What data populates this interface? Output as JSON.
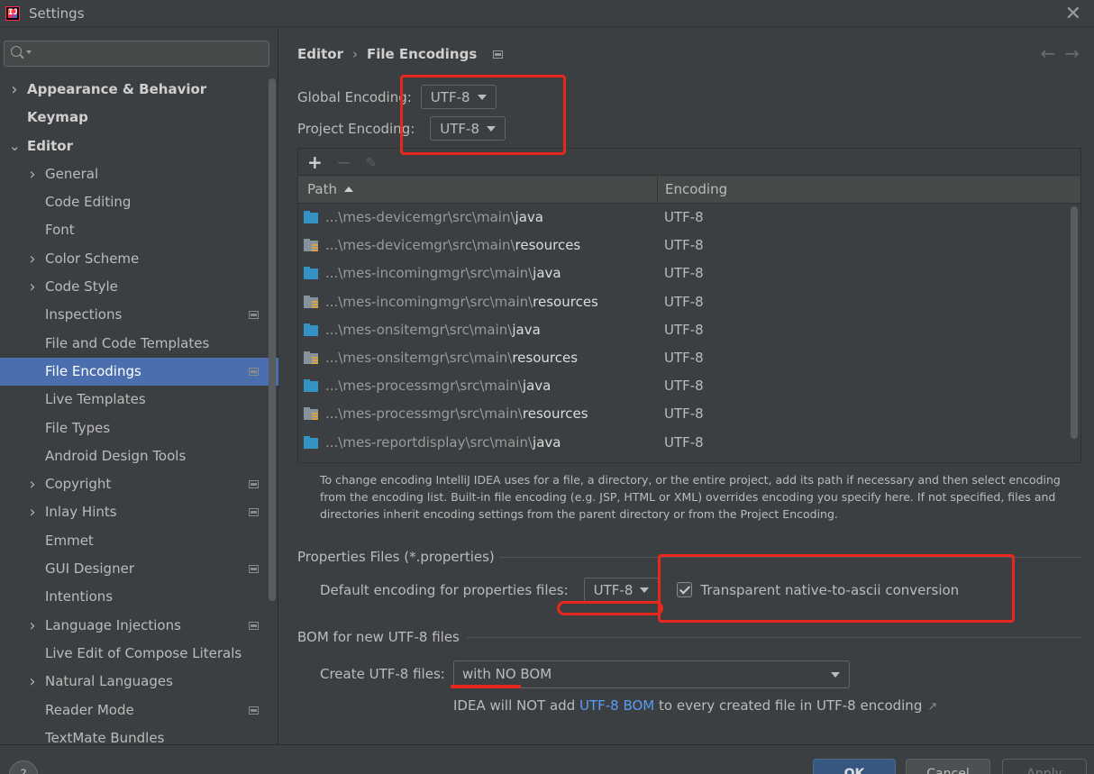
{
  "window": {
    "title": "Settings",
    "icon": "intellij-logo-icon"
  },
  "search": {
    "placeholder": "",
    "value": ""
  },
  "sidebar": {
    "items": [
      {
        "label": "Appearance & Behavior",
        "level": 0,
        "expandable": true,
        "expanded": false,
        "bold": true
      },
      {
        "label": "Keymap",
        "level": 0,
        "expandable": false,
        "bold": true
      },
      {
        "label": "Editor",
        "level": 0,
        "expandable": true,
        "expanded": true,
        "bold": true
      },
      {
        "label": "General",
        "level": 1,
        "expandable": true
      },
      {
        "label": "Code Editing",
        "level": 1
      },
      {
        "label": "Font",
        "level": 1
      },
      {
        "label": "Color Scheme",
        "level": 1,
        "expandable": true
      },
      {
        "label": "Code Style",
        "level": 1,
        "expandable": true
      },
      {
        "label": "Inspections",
        "level": 1,
        "project": true
      },
      {
        "label": "File and Code Templates",
        "level": 1
      },
      {
        "label": "File Encodings",
        "level": 1,
        "project": true,
        "selected": true
      },
      {
        "label": "Live Templates",
        "level": 1
      },
      {
        "label": "File Types",
        "level": 1
      },
      {
        "label": "Android Design Tools",
        "level": 1
      },
      {
        "label": "Copyright",
        "level": 1,
        "expandable": true,
        "project": true
      },
      {
        "label": "Inlay Hints",
        "level": 1,
        "expandable": true,
        "project": true
      },
      {
        "label": "Emmet",
        "level": 1
      },
      {
        "label": "GUI Designer",
        "level": 1,
        "project": true
      },
      {
        "label": "Intentions",
        "level": 1
      },
      {
        "label": "Language Injections",
        "level": 1,
        "expandable": true,
        "project": true
      },
      {
        "label": "Live Edit of Compose Literals",
        "level": 1
      },
      {
        "label": "Natural Languages",
        "level": 1,
        "expandable": true
      },
      {
        "label": "Reader Mode",
        "level": 1,
        "project": true
      },
      {
        "label": "TextMate Bundles",
        "level": 1
      }
    ]
  },
  "breadcrumb": {
    "parent": "Editor",
    "separator": "›",
    "current": "File Encodings"
  },
  "global_encoding": {
    "label": "Global Encoding:",
    "value": "UTF-8"
  },
  "project_encoding": {
    "label": "Project Encoding:",
    "value": "UTF-8"
  },
  "table": {
    "toolbar": {
      "add": "+",
      "remove": "−",
      "edit": "✎"
    },
    "columns": {
      "path": "Path",
      "encoding": "Encoding"
    },
    "rows": [
      {
        "icon": "java",
        "prefix": "...\\mes-devicemgr\\src\\main\\",
        "leaf": "java",
        "encoding": "UTF-8"
      },
      {
        "icon": "resources",
        "prefix": "...\\mes-devicemgr\\src\\main\\",
        "leaf": "resources",
        "encoding": "UTF-8"
      },
      {
        "icon": "java",
        "prefix": "...\\mes-incomingmgr\\src\\main\\",
        "leaf": "java",
        "encoding": "UTF-8"
      },
      {
        "icon": "resources",
        "prefix": "...\\mes-incomingmgr\\src\\main\\",
        "leaf": "resources",
        "encoding": "UTF-8"
      },
      {
        "icon": "java",
        "prefix": "...\\mes-onsitemgr\\src\\main\\",
        "leaf": "java",
        "encoding": "UTF-8"
      },
      {
        "icon": "resources",
        "prefix": "...\\mes-onsitemgr\\src\\main\\",
        "leaf": "resources",
        "encoding": "UTF-8"
      },
      {
        "icon": "java",
        "prefix": "...\\mes-processmgr\\src\\main\\",
        "leaf": "java",
        "encoding": "UTF-8"
      },
      {
        "icon": "resources",
        "prefix": "...\\mes-processmgr\\src\\main\\",
        "leaf": "resources",
        "encoding": "UTF-8"
      },
      {
        "icon": "java",
        "prefix": "...\\mes-reportdisplay\\src\\main\\",
        "leaf": "java",
        "encoding": "UTF-8"
      }
    ]
  },
  "help_text": "To change encoding IntelliJ IDEA uses for a file, a directory, or the entire project, add its path if necessary and then select encoding from the encoding list. Built-in file encoding (e.g. JSP, HTML or XML) overrides encoding you specify here. If not specified, files and directories inherit encoding settings from the parent directory or from the Project Encoding.",
  "properties": {
    "section_title": "Properties Files (*.properties)",
    "default_label": "Default encoding for properties files:",
    "default_value": "UTF-8",
    "transparent_label": "Transparent native-to-ascii conversion",
    "transparent_checked": true
  },
  "bom": {
    "section_title": "BOM for new UTF-8 files",
    "create_label": "Create UTF-8 files:",
    "create_value": "with NO BOM",
    "note_before": "IDEA will NOT add ",
    "note_link": "UTF-8 BOM",
    "note_after": " to every created file in UTF-8 encoding"
  },
  "footer": {
    "help": "?",
    "ok": "OK",
    "cancel": "Cancel",
    "apply": "Apply"
  },
  "colors": {
    "background": "#3c3f41",
    "selection": "#4b6eaf",
    "annotation_red": "#e8281f",
    "link": "#589df6",
    "ok_button": "#365880"
  }
}
